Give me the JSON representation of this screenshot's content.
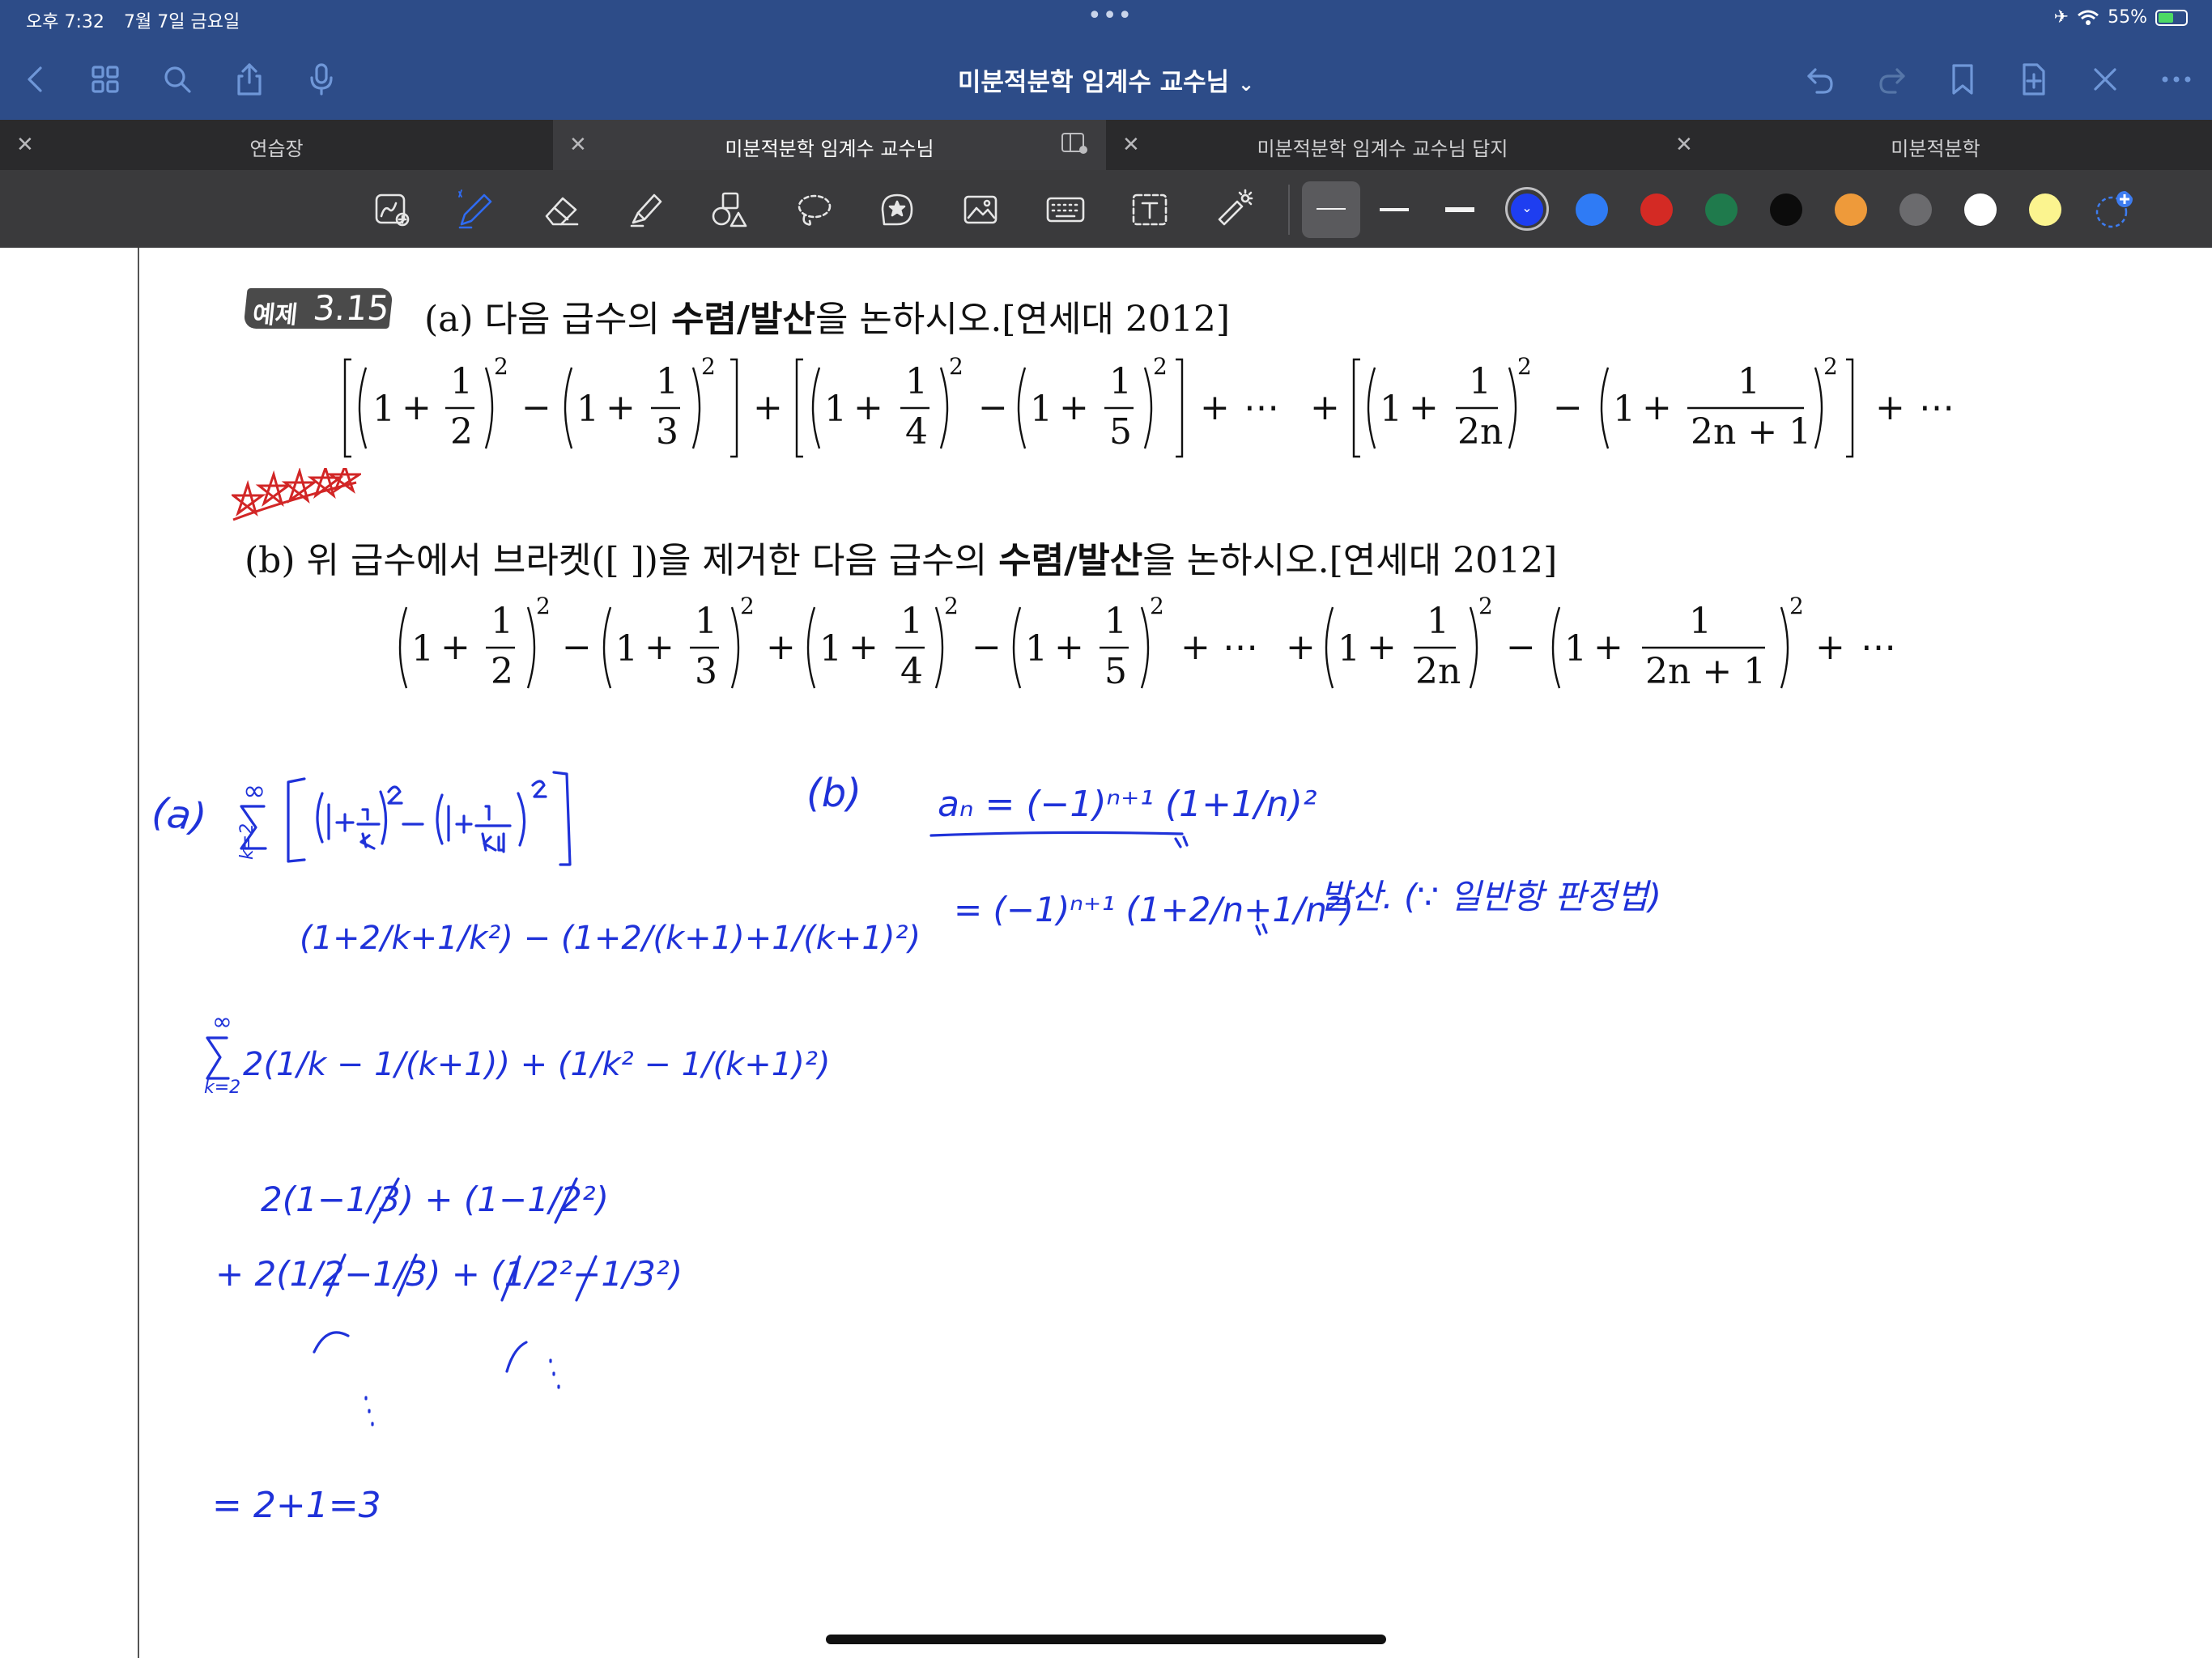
{
  "status_bar": {
    "time": "오후 7:32",
    "date": "7월 7일 금요일",
    "dots": "•••",
    "battery": "55%",
    "battery_level": 0.55
  },
  "nav_bar": {
    "title": "미분적분학 임계수 교수님",
    "title_chevron": "⌄",
    "left_icons": [
      "back-icon",
      "grid-icon",
      "search-icon",
      "share-icon",
      "microphone-icon"
    ],
    "right_icons": [
      "undo-icon",
      "redo-icon",
      "bookmark-icon",
      "add-page-icon",
      "close-icon",
      "more-icon"
    ]
  },
  "tabs": [
    {
      "label": "연습장",
      "active": false
    },
    {
      "label": "미분적분학 임계수 교수님",
      "active": true
    },
    {
      "label": "미분적분학 임계수 교수님 답지",
      "active": false
    },
    {
      "label": "미분적분학",
      "active": false
    }
  ],
  "toolbar": {
    "tools": [
      "image-lasso-icon",
      "pen-icon",
      "eraser-icon",
      "highlighter-icon",
      "shapes-icon",
      "lasso-icon",
      "sticker-icon",
      "image-icon",
      "keyboard-icon",
      "text-icon",
      "laser-pointer-icon"
    ],
    "colors": [
      "#1e3ef0",
      "#2f7bf5",
      "#d42a24",
      "#1f7a4c",
      "#0c0c0c",
      "#ee9a3a",
      "#6b6b6e",
      "#ffffff",
      "#fbf48f"
    ],
    "selected_color": "#1e3ef0"
  },
  "problem": {
    "badge_keyword": "예제",
    "badge_number": "3.15",
    "part_a_prefix": "(a) 다음 급수의 ",
    "part_a_bold": "수렴/발산",
    "part_a_suffix": "을 논하시오.[연세대 2012]",
    "part_b_prefix": "(b) 위 급수에서 브라켓([ ])을 제거한 다음 급수의 ",
    "part_b_bold": "수렴/발산",
    "part_b_suffix": "을 논하시오.[연세대 2012]",
    "math_one": "1",
    "math_two": "2",
    "math_three": "3",
    "math_four": "4",
    "math_five": "5",
    "math_2n": "2n",
    "math_2n1": "2n + 1",
    "math_plus": "+",
    "math_minus": "−",
    "math_dots": "⋯"
  },
  "handwriting": {
    "label_a": "(a)",
    "label_b": "(b)",
    "sum_top": "∞",
    "sum_bottom": "k=2",
    "a_line1": "(1+2/k+1/k²) − (1+2/(k+1)+1/(k+1)²)",
    "a_line2": "2(1/k − 1/(k+1)) + (1/k² − 1/(k+1)²)",
    "a_line3": "2(1−1/3) + (1−1/2²)",
    "a_line4": "+ 2(1/2−1/3) + (1/2²−1/3²)",
    "a_result": "= 2+1=3",
    "b_def": "aₙ = (−1)ⁿ⁺¹ (1+1/n)²",
    "b_expand": "= (−1)ⁿ⁺¹ (1+2/n+1/n²)",
    "b_conclusion": "발산. (∵ 일반항 판정법)"
  }
}
